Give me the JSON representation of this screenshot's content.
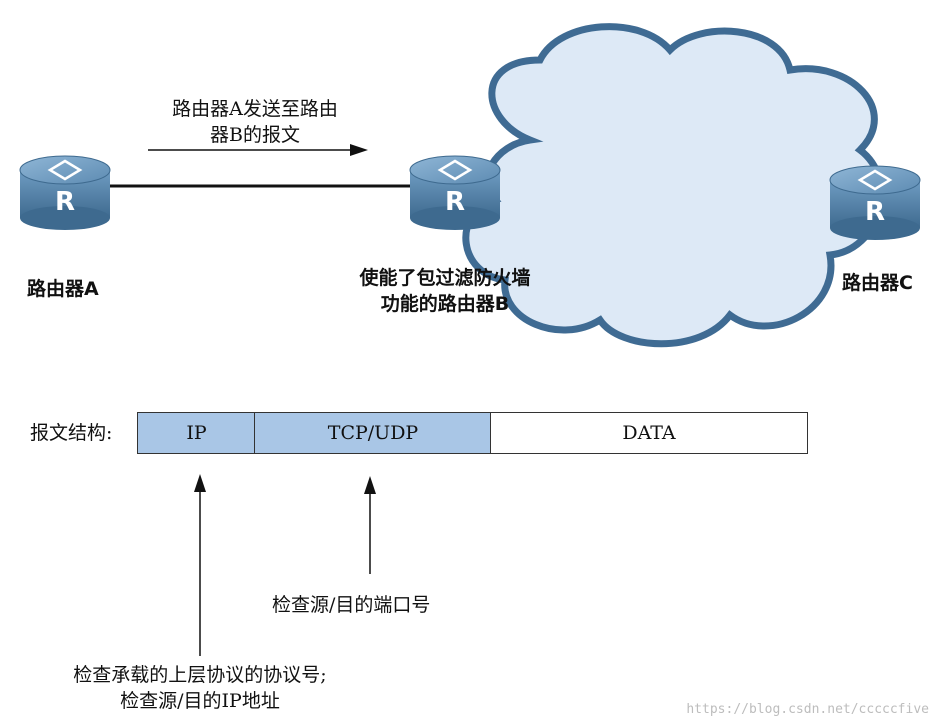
{
  "top_section": {
    "router_a_label": "路由器A",
    "router_b_label_line1": "使能了包过滤防火墙",
    "router_b_label_line2": "功能的路由器B",
    "router_c_label": "路由器C",
    "message_label_line1": "路由器A发送至路由",
    "message_label_line2": "器B的报文",
    "router_icon_letter": "R"
  },
  "packet": {
    "label": "报文结构:",
    "fields": [
      {
        "label": "IP"
      },
      {
        "label": "TCP/UDP"
      },
      {
        "label": "DATA"
      }
    ]
  },
  "annotations": {
    "port_check": "检查源/目的端口号",
    "ip_check_line1": "检查承载的上层协议的协议号;",
    "ip_check_line2": "检查源/目的IP地址"
  },
  "watermark": "https://blog.csdn.net/cccccfive",
  "colors": {
    "router_body": "#4f7fa6",
    "cloud_fill": "#dde9f6",
    "cloud_outline": "#3f6b93",
    "field_blue": "#a9c6e6"
  }
}
